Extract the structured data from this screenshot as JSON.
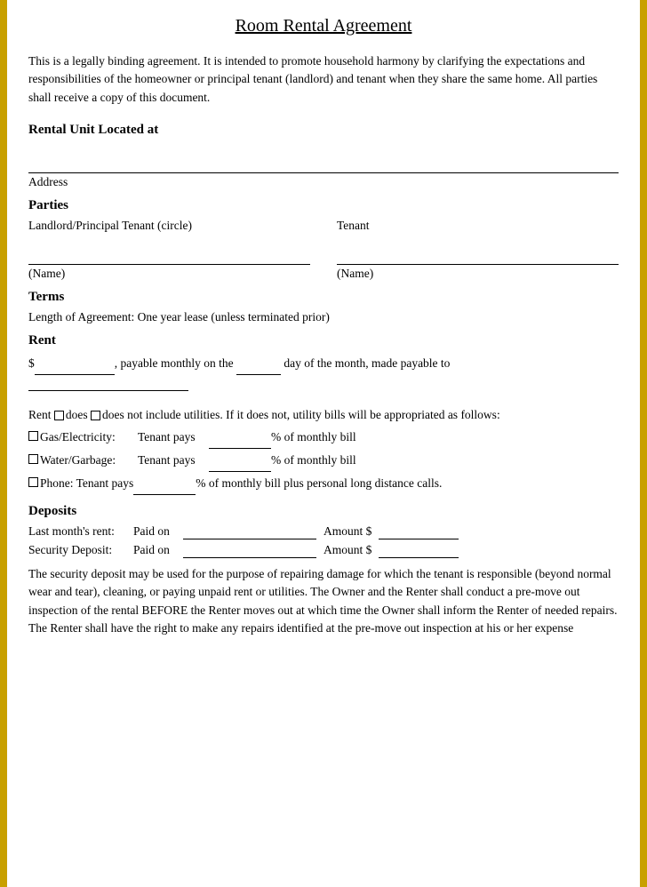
{
  "title": "Room Rental Agreement",
  "intro": "This is a legally binding agreement. It is intended to promote household harmony by clarifying the expectations and responsibilities of the homeowner or principal tenant (landlord) and tenant when they share the same home. All parties shall receive a copy of this document.",
  "sections": {
    "rental_unit": {
      "heading": "Rental Unit Located at",
      "address_label": "Address"
    },
    "parties": {
      "heading": "Parties",
      "landlord_label": "Landlord/Principal Tenant (circle)",
      "tenant_label": "Tenant",
      "name_label": "(Name)",
      "name_label2": "(Name)"
    },
    "terms": {
      "heading": "Terms",
      "length_text": "Length of Agreement: One year lease (unless terminated prior)"
    },
    "rent": {
      "heading": "Rent",
      "line1_prefix": "$",
      "line1_middle": ", payable monthly on the",
      "line1_day_suffix": "day of the month, made payable to",
      "utilities_text": "Rent □does □does not include utilities. If it does not, utility bills will be appropriated as follows:",
      "utilities": [
        {
          "checkbox": true,
          "label": "Gas/Electricity:",
          "pays": "Tenant pays",
          "pct_suffix": "% of monthly bill"
        },
        {
          "checkbox": true,
          "label": "Water/Garbage:",
          "pays": "Tenant pays",
          "pct_suffix": "% of monthly bill"
        },
        {
          "checkbox": true,
          "label": "Phone: Tenant pays",
          "pays": "",
          "pct_suffix": "% of monthly bill plus personal long distance calls."
        }
      ]
    },
    "deposits": {
      "heading": "Deposits",
      "rows": [
        {
          "label": "Last month’s rent:",
          "paid_label": "Paid on",
          "amount_label": "Amount $"
        },
        {
          "label": "Security Deposit:",
          "paid_label": "Paid on",
          "amount_label": "Amount $"
        }
      ],
      "security_text": "The security deposit may be used for the purpose of repairing damage for which the tenant is responsible (beyond normal wear and tear), cleaning, or paying unpaid rent or utilities. The Owner and the Renter shall conduct a pre-move out inspection of the rental BEFORE the Renter moves out at which time the Owner shall inform the Renter of needed repairs. The Renter shall have the right to make any repairs identified at the pre-move out inspection at his or her expense"
    }
  }
}
